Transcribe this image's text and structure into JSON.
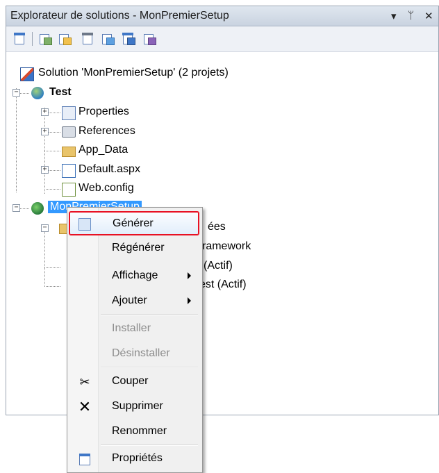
{
  "window": {
    "title": "Explorateur de solutions - MonPremierSetup",
    "controls": {
      "dropdown": "▾",
      "pin": "ᛘ",
      "close": "✕"
    }
  },
  "toolbar": {
    "buttons": [
      "properties-icon",
      "show-all-files-icon",
      "refresh-icon",
      "view-code-icon",
      "view-designer-icon",
      "copy-website-icon",
      "aspnet-config-icon"
    ]
  },
  "tree": {
    "solution": "Solution 'MonPremierSetup' (2 projets)",
    "test_project": "Test",
    "test_children": [
      "Properties",
      "References",
      "App_Data",
      "Default.aspx",
      "Web.config"
    ],
    "setup_project": "MonPremierSetup",
    "hidden_partials": [
      "ées",
      "ramework",
      "(Actif)",
      "est (Actif)"
    ]
  },
  "context_menu": {
    "items": [
      {
        "label": "Générer",
        "icon": "build-icon"
      },
      {
        "label": "Régénérer"
      },
      {
        "label": "Affichage",
        "submenu": true
      },
      {
        "label": "Ajouter",
        "submenu": true
      },
      {
        "label": "Installer",
        "disabled": true
      },
      {
        "label": "Désinstaller",
        "disabled": true
      },
      {
        "label": "Couper",
        "icon": "scissors-icon"
      },
      {
        "label": "Supprimer",
        "icon": "delete-icon"
      },
      {
        "label": "Renommer"
      },
      {
        "label": "Propriétés",
        "icon": "properties-icon"
      }
    ]
  },
  "colors": {
    "selection": "#3399ff",
    "highlight_border": "#e81123",
    "titlebar": "#c9d3e0"
  }
}
